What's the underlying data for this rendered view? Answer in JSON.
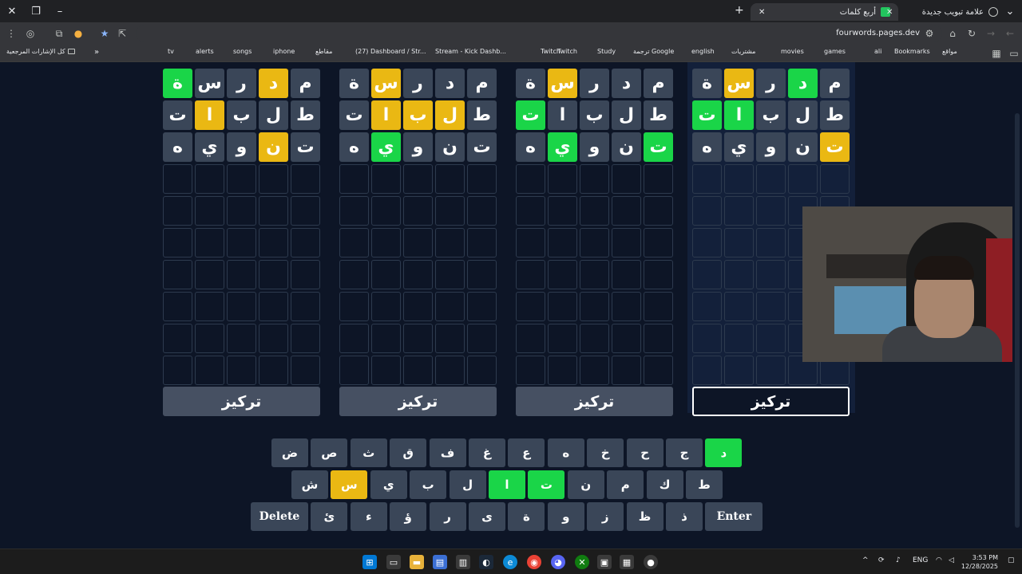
{
  "browser": {
    "tabs": [
      {
        "title": "علامة تبويب جديدة",
        "active": false
      },
      {
        "title": "أربع كلمات",
        "active": true
      }
    ],
    "url": "fourwords.pages.dev",
    "bookmarks": [
      {
        "label": "Bookmarks"
      },
      {
        "label": "مواقع"
      },
      {
        "label": "ali"
      },
      {
        "label": "games"
      },
      {
        "label": "movies"
      },
      {
        "label": "مشتريات"
      },
      {
        "label": "english"
      },
      {
        "label": "ترجمة Google"
      },
      {
        "label": "Study"
      },
      {
        "label": "Twitch"
      },
      {
        "label": "Twitch"
      },
      {
        "label": "Stream - Kick Dashb..."
      },
      {
        "label": "(27) Dashboard / Str..."
      },
      {
        "label": "مقاطع"
      },
      {
        "label": "iphone"
      },
      {
        "label": "songs"
      },
      {
        "label": "alerts"
      },
      {
        "label": "tv"
      }
    ],
    "all_bookmarks_label": "كل الإشارات المرجعية",
    "overflow": "»"
  },
  "colors": {
    "green": "#1ad548",
    "yellow": "#eab813",
    "filled": "#3a4658",
    "background": "#0d1526"
  },
  "boards": [
    {
      "focus_label": "تركيز",
      "focused": false,
      "rows": [
        [
          {
            "l": "ة",
            "s": "g"
          },
          {
            "l": "س",
            "s": "f"
          },
          {
            "l": "ر",
            "s": "f"
          },
          {
            "l": "د",
            "s": "y"
          },
          {
            "l": "م",
            "s": "f"
          }
        ],
        [
          {
            "l": "ت",
            "s": "f"
          },
          {
            "l": "ا",
            "s": "y"
          },
          {
            "l": "ب",
            "s": "f"
          },
          {
            "l": "ل",
            "s": "f"
          },
          {
            "l": "ط",
            "s": "f"
          }
        ],
        [
          {
            "l": "ه",
            "s": "f"
          },
          {
            "l": "ي",
            "s": "f"
          },
          {
            "l": "و",
            "s": "f"
          },
          {
            "l": "ن",
            "s": "y"
          },
          {
            "l": "ت",
            "s": "f"
          }
        ]
      ]
    },
    {
      "focus_label": "تركيز",
      "focused": false,
      "rows": [
        [
          {
            "l": "ة",
            "s": "f"
          },
          {
            "l": "س",
            "s": "y"
          },
          {
            "l": "ر",
            "s": "f"
          },
          {
            "l": "د",
            "s": "f"
          },
          {
            "l": "م",
            "s": "f"
          }
        ],
        [
          {
            "l": "ت",
            "s": "f"
          },
          {
            "l": "ا",
            "s": "y"
          },
          {
            "l": "ب",
            "s": "y"
          },
          {
            "l": "ل",
            "s": "y"
          },
          {
            "l": "ط",
            "s": "f"
          }
        ],
        [
          {
            "l": "ه",
            "s": "f"
          },
          {
            "l": "ي",
            "s": "g"
          },
          {
            "l": "و",
            "s": "f"
          },
          {
            "l": "ن",
            "s": "f"
          },
          {
            "l": "ت",
            "s": "f"
          }
        ]
      ]
    },
    {
      "focus_label": "تركيز",
      "focused": false,
      "rows": [
        [
          {
            "l": "ة",
            "s": "f"
          },
          {
            "l": "س",
            "s": "y"
          },
          {
            "l": "ر",
            "s": "f"
          },
          {
            "l": "د",
            "s": "f"
          },
          {
            "l": "م",
            "s": "f"
          }
        ],
        [
          {
            "l": "ت",
            "s": "g"
          },
          {
            "l": "ا",
            "s": "f"
          },
          {
            "l": "ب",
            "s": "f"
          },
          {
            "l": "ل",
            "s": "f"
          },
          {
            "l": "ط",
            "s": "f"
          }
        ],
        [
          {
            "l": "ه",
            "s": "f"
          },
          {
            "l": "ي",
            "s": "g"
          },
          {
            "l": "و",
            "s": "f"
          },
          {
            "l": "ن",
            "s": "f"
          },
          {
            "l": "ت",
            "s": "g"
          }
        ]
      ]
    },
    {
      "focus_label": "تركيز",
      "focused": true,
      "rows": [
        [
          {
            "l": "ة",
            "s": "f"
          },
          {
            "l": "س",
            "s": "y"
          },
          {
            "l": "ر",
            "s": "f"
          },
          {
            "l": "د",
            "s": "g"
          },
          {
            "l": "م",
            "s": "f"
          }
        ],
        [
          {
            "l": "ت",
            "s": "g"
          },
          {
            "l": "ا",
            "s": "g"
          },
          {
            "l": "ب",
            "s": "f"
          },
          {
            "l": "ل",
            "s": "f"
          },
          {
            "l": "ط",
            "s": "f"
          }
        ],
        [
          {
            "l": "ه",
            "s": "f"
          },
          {
            "l": "ي",
            "s": "f"
          },
          {
            "l": "و",
            "s": "f"
          },
          {
            "l": "ن",
            "s": "f"
          },
          {
            "l": "ت",
            "s": "y"
          }
        ]
      ]
    }
  ],
  "keyboard": {
    "rows": [
      [
        {
          "l": "ض"
        },
        {
          "l": "ص"
        },
        {
          "l": "ث"
        },
        {
          "l": "ق"
        },
        {
          "l": "ف"
        },
        {
          "l": "غ"
        },
        {
          "l": "ع"
        },
        {
          "l": "ه"
        },
        {
          "l": "خ"
        },
        {
          "l": "ح"
        },
        {
          "l": "ج"
        },
        {
          "l": "د",
          "s": "g"
        }
      ],
      [
        {
          "l": "ش"
        },
        {
          "l": "س",
          "s": "y"
        },
        {
          "l": "ي"
        },
        {
          "l": "ب"
        },
        {
          "l": "ل"
        },
        {
          "l": "ا",
          "s": "g"
        },
        {
          "l": "ت",
          "s": "g"
        },
        {
          "l": "ن"
        },
        {
          "l": "م"
        },
        {
          "l": "ك"
        },
        {
          "l": "ط"
        }
      ],
      [
        {
          "l": "Delete",
          "w": true
        },
        {
          "l": "ئ"
        },
        {
          "l": "ء"
        },
        {
          "l": "ؤ"
        },
        {
          "l": "ر"
        },
        {
          "l": "ى"
        },
        {
          "l": "ة"
        },
        {
          "l": "و"
        },
        {
          "l": "ز"
        },
        {
          "l": "ظ"
        },
        {
          "l": "ذ"
        },
        {
          "l": "Enter",
          "w": true
        }
      ]
    ]
  },
  "taskbar": {
    "language": "ENG",
    "time": "3:53 PM",
    "date": "12/28/2025",
    "tray_overflow": "^"
  }
}
